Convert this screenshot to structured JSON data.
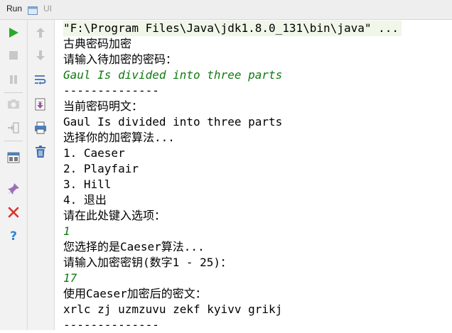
{
  "tab": {
    "title": "Run",
    "name": "UI"
  },
  "toolbar_left": [
    "run-icon",
    "stop-icon",
    "pause-icon",
    "dump-threads-icon",
    "restore-layout-icon",
    "layout-icon",
    "pin-icon",
    "close-icon",
    "help-icon"
  ],
  "toolbar_right": [
    "scroll-up-icon",
    "scroll-down-icon",
    "soft-wrap-icon",
    "scroll-to-end-icon",
    "print-icon",
    "clear-all-icon"
  ],
  "colors": {
    "run": "#2ca82c",
    "input": "#107a10",
    "close": "#d9322c",
    "help": "#2a84d6"
  },
  "console": {
    "lines": [
      {
        "text": "\"F:\\Program Files\\Java\\jdk1.8.0_131\\bin\\java\" ...",
        "kind": "cmd"
      },
      {
        "text": "古典密码加密",
        "kind": "out"
      },
      {
        "text": "请输入待加密的密码：",
        "kind": "out"
      },
      {
        "text": "Gaul Is divided into three parts",
        "kind": "input"
      },
      {
        "text": "--------------",
        "kind": "out"
      },
      {
        "text": "当前密码明文：",
        "kind": "out"
      },
      {
        "text": "Gaul Is divided into three parts",
        "kind": "out"
      },
      {
        "text": "选择你的加密算法...",
        "kind": "out"
      },
      {
        "text": "1. Caeser",
        "kind": "out"
      },
      {
        "text": "2. Playfair",
        "kind": "out"
      },
      {
        "text": "3. Hill",
        "kind": "out"
      },
      {
        "text": "4. 退出",
        "kind": "out"
      },
      {
        "text": "请在此处键入选项：",
        "kind": "out"
      },
      {
        "text": "1",
        "kind": "input"
      },
      {
        "text": "您选择的是Caeser算法...",
        "kind": "out"
      },
      {
        "text": "请输入加密密钥(数字1 - 25)：",
        "kind": "out"
      },
      {
        "text": "17",
        "kind": "input"
      },
      {
        "text": "使用Caeser加密后的密文：",
        "kind": "out"
      },
      {
        "text": "xrlc zj uzmzuvu zekf kyivv grikj",
        "kind": "out"
      },
      {
        "text": "--------------",
        "kind": "out"
      }
    ]
  }
}
